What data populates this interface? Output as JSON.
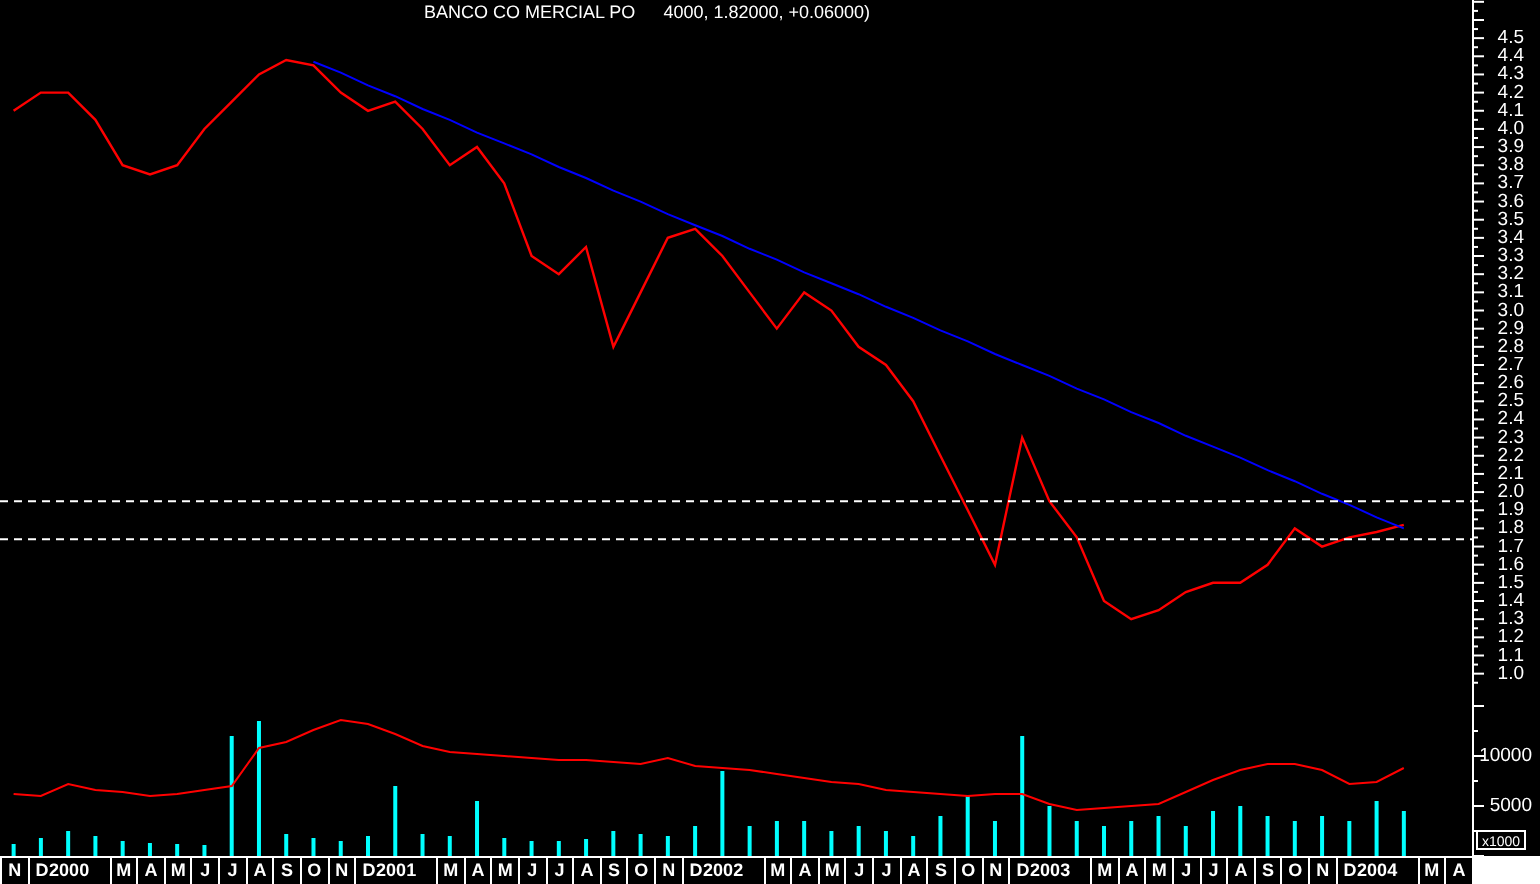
{
  "title": {
    "name": "BANCO CO MERCIAL PO",
    "values": "4000, 1.82000, +0.06000)"
  },
  "price_chart": {
    "chart_data": {
      "type": "line",
      "series": [
        {
          "color": "#ff0000",
          "values": [
            4.1,
            4.2,
            4.2,
            4.05,
            3.8,
            3.75,
            3.8,
            4.0,
            4.15,
            4.3,
            4.38,
            4.35,
            4.2,
            4.1,
            4.15,
            4.0,
            3.8,
            3.9,
            3.7,
            3.3,
            3.2,
            3.35,
            2.8,
            3.1,
            3.4,
            3.45,
            3.3,
            3.1,
            2.9,
            3.1,
            3.0,
            2.8,
            2.7,
            2.5,
            2.2,
            1.9,
            1.6,
            2.3,
            1.95,
            1.75,
            1.4,
            1.3,
            1.35,
            1.45,
            1.5,
            1.5,
            1.6,
            1.8,
            1.7,
            1.75,
            1.78,
            1.82,
            null,
            null
          ]
        },
        {
          "color": "#0000ff",
          "values": [
            null,
            null,
            null,
            null,
            null,
            null,
            null,
            null,
            null,
            null,
            null,
            4.37,
            4.31,
            4.24,
            4.18,
            4.11,
            4.05,
            3.98,
            3.92,
            3.86,
            3.79,
            3.73,
            3.66,
            3.6,
            3.53,
            3.47,
            3.41,
            3.34,
            3.28,
            3.21,
            3.15,
            3.09,
            3.02,
            2.96,
            2.89,
            2.83,
            2.76,
            2.7,
            2.64,
            2.57,
            2.51,
            2.44,
            2.38,
            2.31,
            2.25,
            2.19,
            2.12,
            2.06,
            1.99,
            1.93,
            1.86,
            1.8,
            null,
            null
          ]
        }
      ],
      "ylim": [
        0.91,
        4.71
      ],
      "yticks": [
        {
          "value": 4.5,
          "label": "4.5"
        },
        {
          "value": 4.4,
          "label": "4.4"
        },
        {
          "value": 4.3,
          "label": "4.3"
        },
        {
          "value": 4.2,
          "label": "4.2"
        },
        {
          "value": 4.1,
          "label": "4.1"
        },
        {
          "value": 4.0,
          "label": "4.0"
        },
        {
          "value": 3.9,
          "label": "3.9"
        },
        {
          "value": 3.8,
          "label": "3.8"
        },
        {
          "value": 3.7,
          "label": "3.7"
        },
        {
          "value": 3.6,
          "label": "3.6"
        },
        {
          "value": 3.5,
          "label": "3.5"
        },
        {
          "value": 3.4,
          "label": "3.4"
        },
        {
          "value": 3.3,
          "label": "3.3"
        },
        {
          "value": 3.2,
          "label": "3.2"
        },
        {
          "value": 3.1,
          "label": "3.1"
        },
        {
          "value": 3.0,
          "label": "3.0"
        },
        {
          "value": 2.9,
          "label": "2.9"
        },
        {
          "value": 2.8,
          "label": "2.8"
        },
        {
          "value": 2.7,
          "label": "2.7"
        },
        {
          "value": 2.6,
          "label": "2.6"
        },
        {
          "value": 2.5,
          "label": "2.5"
        },
        {
          "value": 2.4,
          "label": "2.4"
        },
        {
          "value": 2.3,
          "label": "2.3"
        },
        {
          "value": 2.2,
          "label": "2.2"
        },
        {
          "value": 2.1,
          "label": "2.1"
        },
        {
          "value": 2.0,
          "label": "2.0"
        },
        {
          "value": 1.9,
          "label": "1.9"
        },
        {
          "value": 1.8,
          "label": "1.8"
        },
        {
          "value": 1.7,
          "label": "1.7"
        },
        {
          "value": 1.6,
          "label": "1.6"
        },
        {
          "value": 1.5,
          "label": "1.5"
        },
        {
          "value": 1.4,
          "label": "1.4"
        },
        {
          "value": 1.3,
          "label": "1.3"
        },
        {
          "value": 1.2,
          "label": "1.2"
        },
        {
          "value": 1.1,
          "label": "1.1"
        },
        {
          "value": 1.0,
          "label": "1.0"
        }
      ],
      "ref_lines": [
        {
          "axis": "y",
          "value": 1.95
        },
        {
          "axis": "y",
          "value": 1.74
        }
      ]
    }
  },
  "volume_chart": {
    "unit_label": "x1000",
    "chart_data": {
      "type": "bar",
      "categories": [
        "N",
        "D",
        "2000",
        null,
        "M",
        "A",
        "M",
        "J",
        "J",
        "A",
        "S",
        "O",
        "N",
        "D",
        "2001",
        null,
        "M",
        "A",
        "M",
        "J",
        "J",
        "A",
        "S",
        "O",
        "N",
        "D",
        "2002",
        null,
        "M",
        "A",
        "M",
        "J",
        "J",
        "A",
        "S",
        "O",
        "N",
        "D",
        "2003",
        null,
        "M",
        "A",
        "M",
        "J",
        "J",
        "A",
        "S",
        "O",
        "N",
        "D",
        "2004",
        null,
        "M",
        "A"
      ],
      "series": [
        {
          "color": "#00ffff",
          "values": [
            1200,
            1800,
            2500,
            2000,
            1500,
            1300,
            1200,
            1100,
            12000,
            13500,
            2200,
            1800,
            1500,
            2000,
            7000,
            2200,
            2000,
            5500,
            1800,
            1500,
            1500,
            1700,
            2500,
            2200,
            2000,
            3000,
            8500,
            3000,
            3500,
            3500,
            2500,
            3000,
            2500,
            2000,
            4000,
            6000,
            3500,
            12000,
            5000,
            3500,
            3000,
            3500,
            4000,
            3000,
            4500,
            5000,
            4000,
            3500,
            4000,
            3500,
            5500,
            4500,
            null,
            null
          ]
        },
        {
          "type": "line",
          "color": "#ff0000",
          "values": [
            6200,
            6000,
            7200,
            6600,
            6400,
            6000,
            6200,
            6600,
            7000,
            10800,
            11400,
            12600,
            13600,
            13200,
            12200,
            11000,
            10400,
            10200,
            10000,
            9800,
            9600,
            9600,
            9400,
            9200,
            9800,
            9000,
            8800,
            8600,
            8200,
            7800,
            7400,
            7200,
            6600,
            6400,
            6200,
            6000,
            6200,
            6200,
            5200,
            4600,
            4800,
            5000,
            5200,
            6400,
            7600,
            8600,
            9200,
            9200,
            8600,
            7200,
            7400,
            8800,
            null,
            null
          ]
        }
      ],
      "ylim": [
        0,
        16600
      ],
      "yticks": [
        {
          "value": 10000,
          "label": "10000"
        },
        {
          "value": 5000,
          "label": "5000"
        }
      ]
    }
  }
}
